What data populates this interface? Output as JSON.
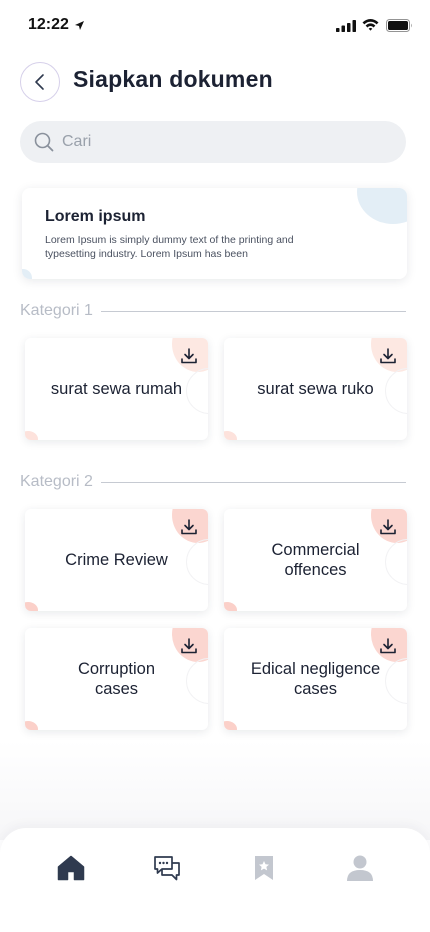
{
  "status_bar": {
    "time": "12:22"
  },
  "header": {
    "title": "Siapkan dokumen"
  },
  "search": {
    "placeholder": "Cari"
  },
  "info_card": {
    "title": "Lorem ipsum",
    "body": "Lorem Ipsum is simply dummy text of the printing and typesetting industry. Lorem Ipsum has been"
  },
  "categories": [
    {
      "label": "Kategori 1",
      "items": [
        {
          "label": "surat sewa rumah"
        },
        {
          "label": "surat sewa ruko"
        }
      ]
    },
    {
      "label": "Kategori 2",
      "items": [
        {
          "label": "Crime Review"
        },
        {
          "label": "Commercial offences"
        },
        {
          "label": "Corruption cases"
        },
        {
          "label": "Edical negligence cases"
        }
      ]
    }
  ],
  "bottom_nav": [
    {
      "icon": "home-icon",
      "active": true
    },
    {
      "icon": "chat-icon",
      "active": false
    },
    {
      "icon": "bookmark-icon",
      "active": false
    },
    {
      "icon": "profile-icon",
      "active": false
    }
  ],
  "colors": {
    "accent_dark": "#2f3a4f",
    "inactive": "#c3c7cf",
    "blob_pink": "#fde8e2",
    "blob_blue": "#e3eef6"
  }
}
